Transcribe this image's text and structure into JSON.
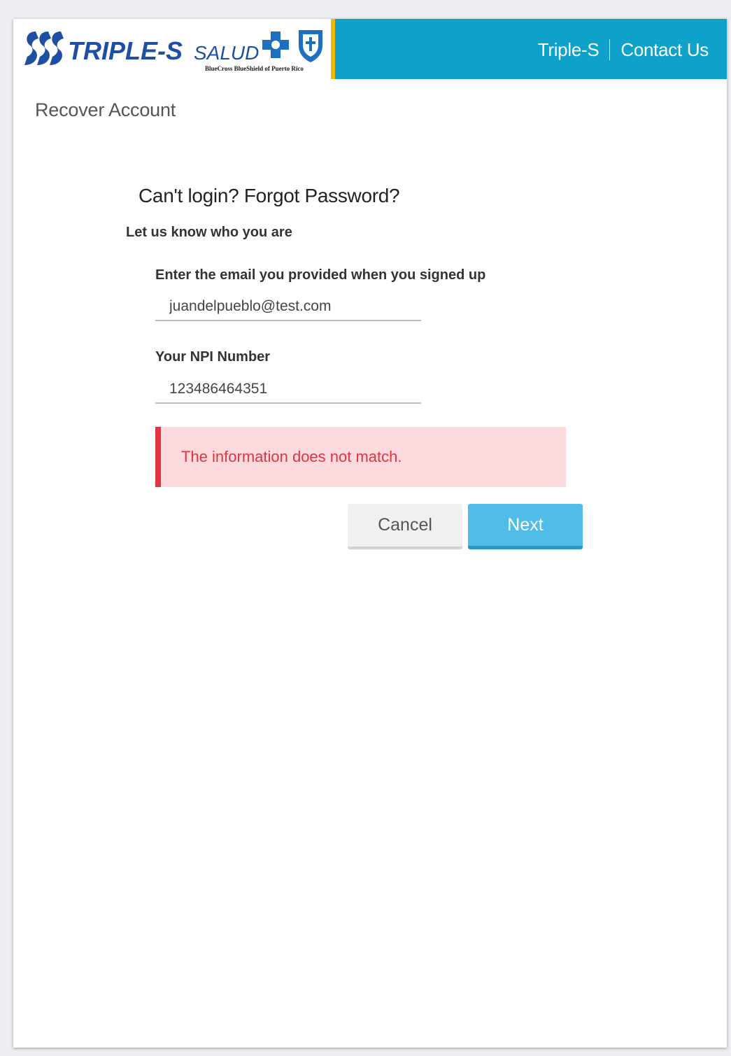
{
  "header": {
    "logo": {
      "wordmark": "TRIPLE-S",
      "tagline": "SALUD",
      "subline": "BlueCross BlueShield of Puerto Rico"
    },
    "nav": {
      "link_triple_s": "Triple-S",
      "link_contact": "Contact Us"
    }
  },
  "page": {
    "title": "Recover Account"
  },
  "form": {
    "heading": "Can't login? Forgot Password?",
    "subheading": "Let us know who you are",
    "email": {
      "label": "Enter the email you provided when you signed up",
      "value": "juandelpueblo@test.com"
    },
    "npi": {
      "label": "Your NPI Number",
      "value": "123486464351"
    },
    "error": "The information does not match.",
    "cancel_label": "Cancel",
    "next_label": "Next"
  },
  "colors": {
    "nav_blue": "#0ea2cb",
    "accent_yellow": "#f2b705",
    "error_red": "#e0343f",
    "error_bg": "#fddadd",
    "next_button": "#4fbde8"
  }
}
